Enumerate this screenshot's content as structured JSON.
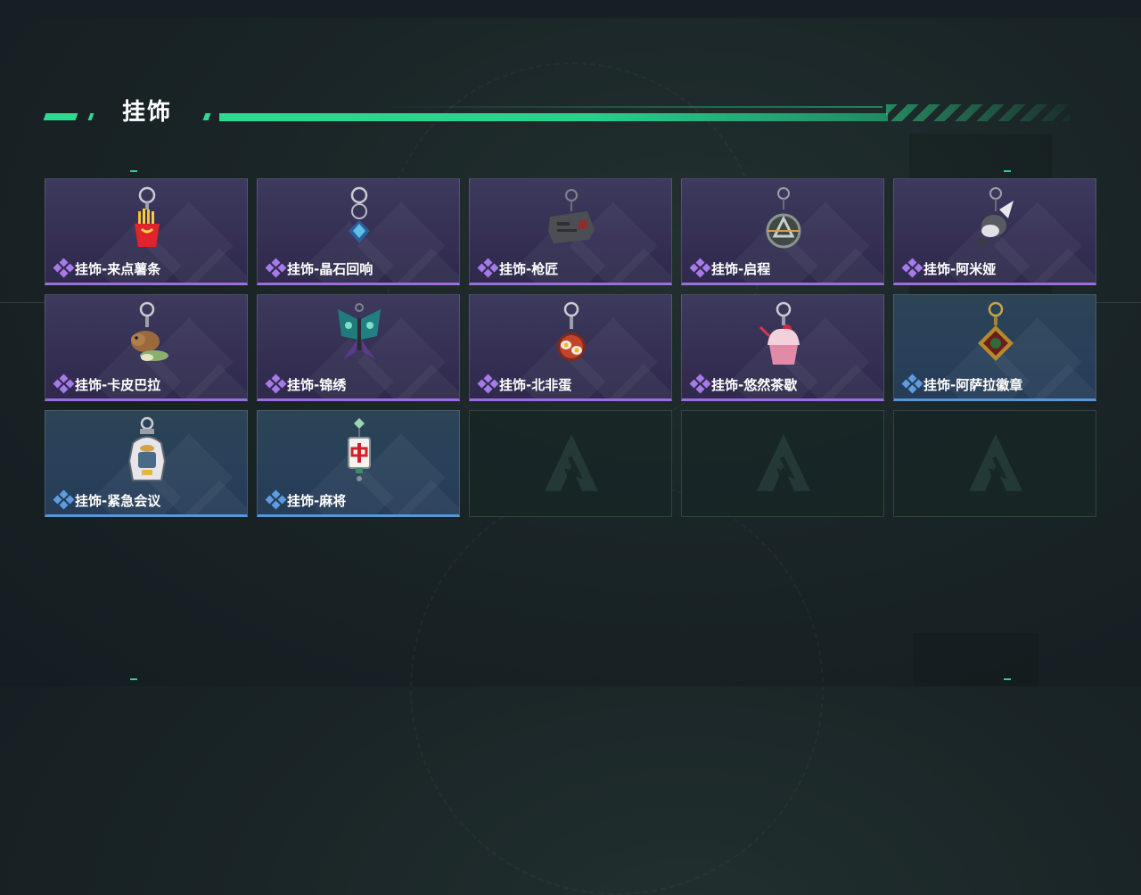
{
  "section": {
    "title": "挂饰"
  },
  "colors": {
    "accent": "#2fd990",
    "rarity_purple": "#9b6de0",
    "rarity_blue": "#5a95d8"
  },
  "items": [
    {
      "name": "挂饰-来点薯条",
      "rarity": "purple",
      "icon": "french-fries-charm-icon"
    },
    {
      "name": "挂饰-晶石回响",
      "rarity": "purple",
      "icon": "crystal-charm-icon"
    },
    {
      "name": "挂饰-枪匠",
      "rarity": "purple",
      "icon": "gunsmith-charm-icon"
    },
    {
      "name": "挂饰-启程",
      "rarity": "purple",
      "icon": "departure-emblem-charm-icon"
    },
    {
      "name": "挂饰-阿米娅",
      "rarity": "purple",
      "icon": "amiya-charm-icon"
    },
    {
      "name": "挂饰-卡皮巴拉",
      "rarity": "purple",
      "icon": "capybara-charm-icon"
    },
    {
      "name": "挂饰-锦绣",
      "rarity": "purple",
      "icon": "butterfly-charm-icon"
    },
    {
      "name": "挂饰-北非蛋",
      "rarity": "purple",
      "icon": "shakshuka-charm-icon"
    },
    {
      "name": "挂饰-悠然茶歇",
      "rarity": "purple",
      "icon": "cupcake-charm-icon"
    },
    {
      "name": "挂饰-阿萨拉徽章",
      "rarity": "blue",
      "icon": "asala-badge-charm-icon"
    },
    {
      "name": "挂饰-紧急会议",
      "rarity": "blue",
      "icon": "emergency-meeting-charm-icon"
    },
    {
      "name": "挂饰-麻将",
      "rarity": "blue",
      "icon": "mahjong-tile-charm-icon"
    }
  ],
  "empty_slots": 3
}
